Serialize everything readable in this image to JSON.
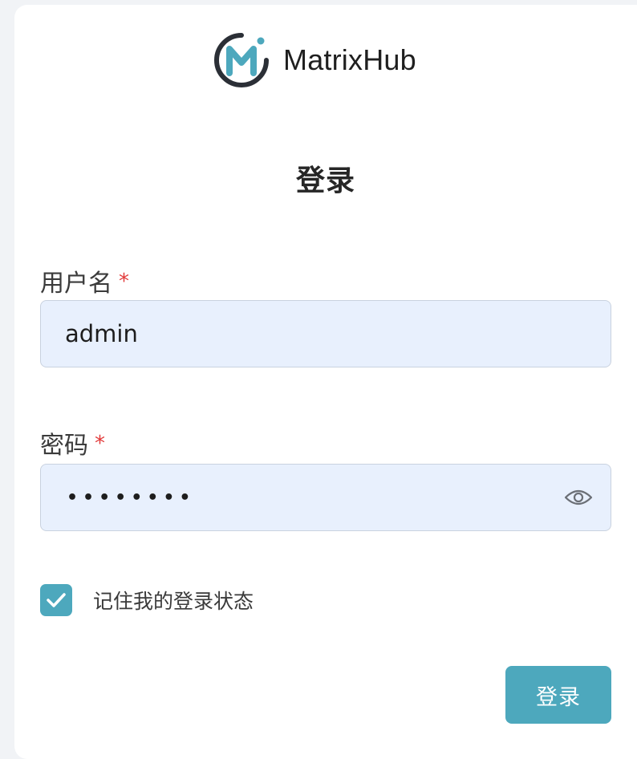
{
  "brand": {
    "name": "MatrixHub",
    "logo_icon": "matrixhub-logo-icon",
    "logo_colors": {
      "ring": "#2b2f36",
      "letter": "#4da8bd",
      "dot": "#4da8bd"
    }
  },
  "login_form": {
    "title": "登录",
    "username": {
      "label": "用户名",
      "required_mark": "*",
      "value": "admin"
    },
    "password": {
      "label": "密码",
      "required_mark": "*",
      "masked_value": "••••••••",
      "visibility_toggle_icon": "eye-icon"
    },
    "remember_me": {
      "label": "记住我的登录状态",
      "checked": true,
      "check_icon": "checkmark-icon"
    },
    "submit_label": "登录"
  },
  "colors": {
    "accent": "#4da8bd",
    "input_background": "#e8f0fd",
    "input_border": "#c9d2df",
    "required": "#e23b3b",
    "page_background": "#f1f3f6",
    "card_background": "#ffffff"
  }
}
